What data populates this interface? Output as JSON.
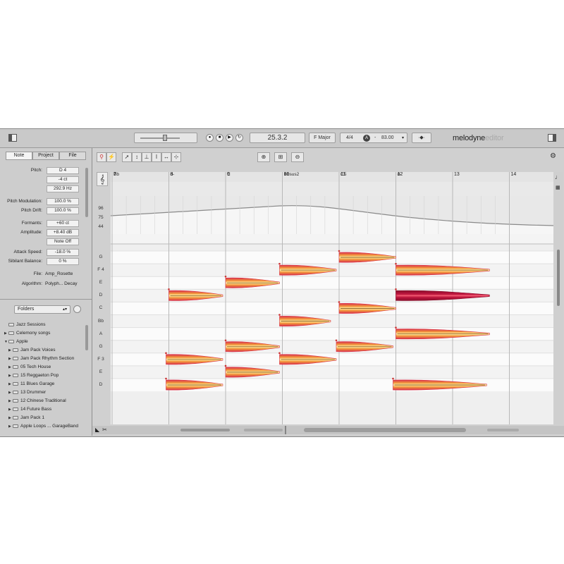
{
  "app": {
    "logo_main": "melodyne",
    "logo_sub": "editor"
  },
  "toolbar": {
    "position": "25.3.2",
    "key": "F Major",
    "time_signature": "4/4",
    "tempo": "83.00",
    "tempo_badge": "A",
    "tempo_minus": "-"
  },
  "inspector": {
    "tabs": [
      "Note",
      "Project",
      "File"
    ],
    "pitch_label": "Pitch:",
    "pitch_note": "D 4",
    "pitch_cents": "-4 ct",
    "pitch_hz": "292.9 Hz",
    "pitch_modulation_label": "Pitch Modulation:",
    "pitch_modulation": "100.0 %",
    "pitch_drift_label": "Pitch Drift:",
    "pitch_drift": "100.0 %",
    "formants_label": "Formants:",
    "formants": "+60 ct",
    "amplitude_label": "Amplitude:",
    "amplitude": "+8.40 dB",
    "note_off": "Note Off",
    "attack_speed_label": "Attack Speed:",
    "attack_speed": "-18.0 %",
    "sibilant_label": "Sibilant Balance:",
    "sibilant": "0 %",
    "file_label": "File:",
    "file": "Amp_Rosette",
    "algorithm_label": "Algorithm:",
    "algorithm": "Polyph... Decay"
  },
  "browser": {
    "dropdown": "Folders",
    "items": [
      {
        "label": "Jazz Sessions",
        "expanded": "none",
        "depth": 0
      },
      {
        "label": "Celemony songs",
        "expanded": "closed",
        "depth": 0
      },
      {
        "label": "Apple",
        "expanded": "open",
        "depth": 0
      },
      {
        "label": "Jam Pack Voices",
        "expanded": "closed",
        "depth": 1
      },
      {
        "label": "Jam Pack Rhythm Section",
        "expanded": "closed",
        "depth": 1
      },
      {
        "label": "05 Tech House",
        "expanded": "closed",
        "depth": 1
      },
      {
        "label": "15 Reggaeton Pop",
        "expanded": "closed",
        "depth": 1
      },
      {
        "label": "11 Blues Garage",
        "expanded": "closed",
        "depth": 1
      },
      {
        "label": "13 Drummer",
        "expanded": "closed",
        "depth": 1
      },
      {
        "label": "12 Chinese Traditional",
        "expanded": "closed",
        "depth": 1
      },
      {
        "label": "14 Future Bass",
        "expanded": "closed",
        "depth": 1
      },
      {
        "label": "Jam Pack 1",
        "expanded": "closed",
        "depth": 1
      },
      {
        "label": "Apple Loops ... GarageBand",
        "expanded": "closed",
        "depth": 1
      }
    ]
  },
  "editor": {
    "bars": [
      "7",
      "8",
      "9",
      "10",
      "11",
      "12",
      "13",
      "14"
    ],
    "chords": [
      "Bb",
      "d-",
      "C",
      "Bbsus2",
      "C5",
      "d-"
    ],
    "tempo_ticks": [
      "96",
      "75",
      "44"
    ],
    "pitch_labels": [
      "G",
      "F 4",
      "E",
      "D",
      "C",
      "Bb",
      "A",
      "G",
      "F 3",
      "E",
      "D"
    ],
    "colors": {
      "blob_outer": "#d8304a",
      "blob_mid": "#f39a3c",
      "blob_inner": "#fff3b0",
      "selected": "#b8123a"
    }
  },
  "notes": [
    {
      "pitch": "D",
      "octave": 4,
      "start_bar": 8.0,
      "end_bar": 8.95,
      "selected": false
    },
    {
      "pitch": "E",
      "octave": 4,
      "start_bar": 9.0,
      "end_bar": 9.95,
      "selected": false
    },
    {
      "pitch": "F",
      "octave": 4,
      "start_bar": 9.95,
      "end_bar": 10.95,
      "selected": false
    },
    {
      "pitch": "G",
      "octave": 4,
      "start_bar": 11.0,
      "end_bar": 12.0,
      "selected": false
    },
    {
      "pitch": "F",
      "octave": 4,
      "start_bar": 12.0,
      "end_bar": 13.65,
      "selected": false
    },
    {
      "pitch": "D",
      "octave": 4,
      "start_bar": 12.0,
      "end_bar": 13.65,
      "selected": true
    },
    {
      "pitch": "C",
      "octave": 4,
      "start_bar": 11.0,
      "end_bar": 12.0,
      "selected": false
    },
    {
      "pitch": "Bb",
      "octave": 3,
      "start_bar": 9.95,
      "end_bar": 10.85,
      "selected": false
    },
    {
      "pitch": "A",
      "octave": 3,
      "start_bar": 12.0,
      "end_bar": 13.65,
      "selected": false
    },
    {
      "pitch": "G",
      "octave": 3,
      "start_bar": 9.0,
      "end_bar": 9.95,
      "selected": false
    },
    {
      "pitch": "G",
      "octave": 3,
      "start_bar": 10.95,
      "end_bar": 11.95,
      "selected": false
    },
    {
      "pitch": "F",
      "octave": 3,
      "start_bar": 7.95,
      "end_bar": 8.95,
      "selected": false
    },
    {
      "pitch": "F",
      "octave": 3,
      "start_bar": 9.95,
      "end_bar": 10.95,
      "selected": false
    },
    {
      "pitch": "E",
      "octave": 3,
      "start_bar": 9.0,
      "end_bar": 9.95,
      "selected": false
    },
    {
      "pitch": "D",
      "octave": 3,
      "start_bar": 7.95,
      "end_bar": 8.95,
      "selected": false
    },
    {
      "pitch": "D",
      "octave": 3,
      "start_bar": 11.95,
      "end_bar": 13.6,
      "selected": false
    }
  ]
}
